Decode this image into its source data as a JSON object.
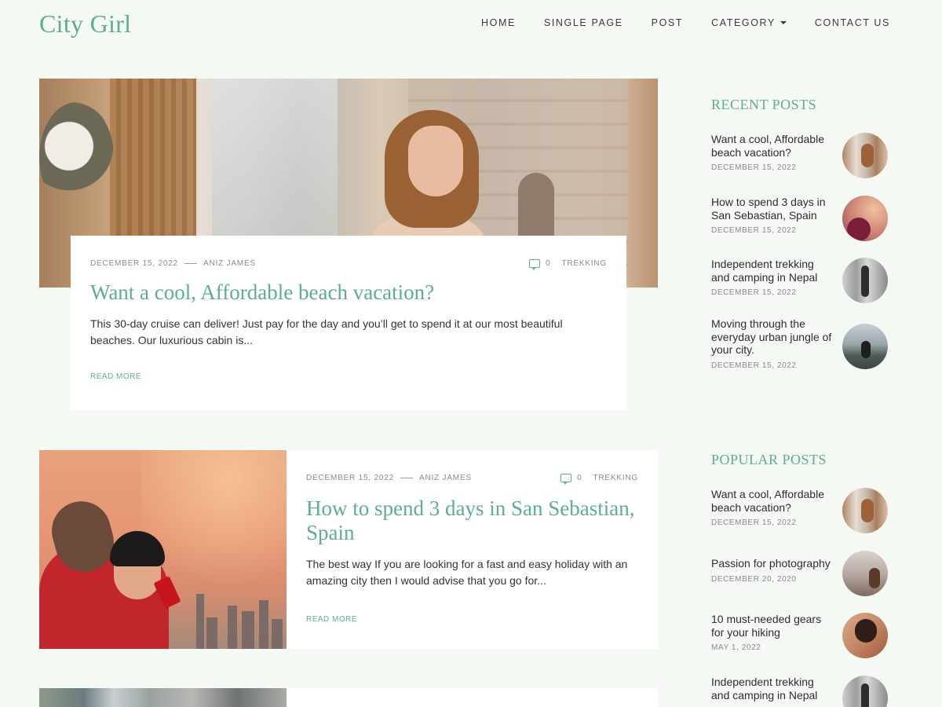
{
  "site": {
    "logo": "City Girl"
  },
  "nav": {
    "items": [
      {
        "label": "HOME"
      },
      {
        "label": "SINGLE PAGE"
      },
      {
        "label": "POST"
      },
      {
        "label": "CATEGORY",
        "has_dropdown": true
      },
      {
        "label": "CONTACT US"
      }
    ]
  },
  "posts": [
    {
      "date": "DECEMBER 15, 2022",
      "author": "ANIZ JAMES",
      "comments": "0",
      "category": "TREKKING",
      "title": "Want a cool, Affordable beach vacation?",
      "excerpt": "This 30-day cruise can deliver! Just pay for the day and you’ll get to spend it at our most beautiful beaches. Our luxurious cabin is...",
      "read_more": "READ MORE"
    },
    {
      "date": "DECEMBER 15, 2022",
      "author": "ANIZ JAMES",
      "comments": "0",
      "category": "TREKKING",
      "title": "How to spend 3 days in San Sebastian, Spain",
      "excerpt": "The best way If you are looking for a fast and easy holiday with an amazing city then I would advise that you go for...",
      "read_more": "READ MORE"
    }
  ],
  "sidebar": {
    "recent_title": "RECENT POSTS",
    "recent": [
      {
        "title": "Want a cool, Affordable beach vacation?",
        "date": "DECEMBER 15, 2022"
      },
      {
        "title": "How to spend 3 days in San Sebastian, Spain",
        "date": "DECEMBER 15, 2022"
      },
      {
        "title": "Independent trekking and camping in Nepal",
        "date": "DECEMBER 15, 2022"
      },
      {
        "title": "Moving through the everyday urban jungle of your city.",
        "date": "DECEMBER 15, 2022"
      }
    ],
    "popular_title": "POPULAR POSTS",
    "popular": [
      {
        "title": "Want a cool, Affordable beach vacation?",
        "date": "DECEMBER 15, 2022"
      },
      {
        "title": "Passion for photography",
        "date": "DECEMBER 20, 2020"
      },
      {
        "title": "10 must-needed gears for your hiking",
        "date": "MAY 1, 2022"
      },
      {
        "title": "Independent trekking and camping in Nepal",
        "date": ""
      }
    ]
  },
  "colors": {
    "accent": "#5cae8d",
    "background": "#f4f9f4",
    "card": "#ffffff",
    "text": "#2b2b2b",
    "muted": "#8a8a8a"
  }
}
